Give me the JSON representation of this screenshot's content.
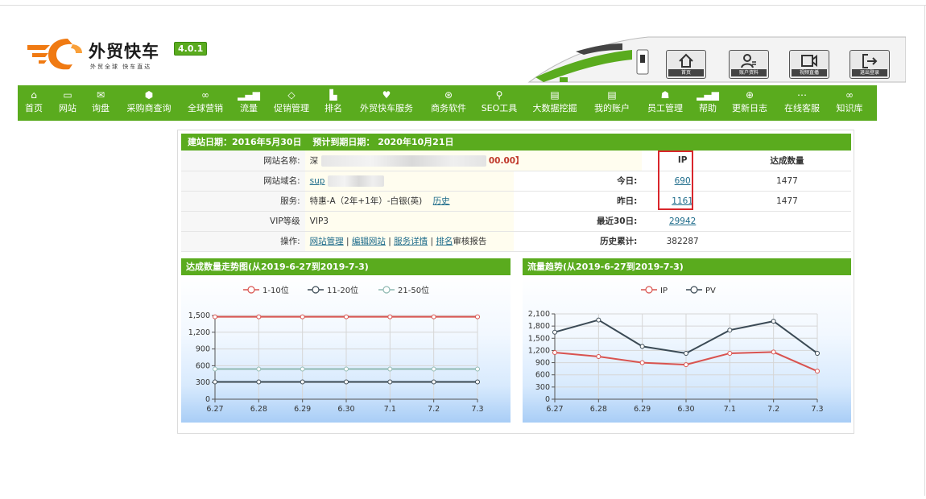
{
  "brand": {
    "title": "外贸快车",
    "version": "4.0.1",
    "slogan": "外贸全球 快车直达"
  },
  "top_buttons": [
    {
      "label": "首页",
      "icon": "home-icon"
    },
    {
      "label": "账户资料",
      "icon": "user-icon"
    },
    {
      "label": "视频直播",
      "icon": "video-icon"
    },
    {
      "label": "退出登录",
      "icon": "logout-icon"
    }
  ],
  "nav": [
    {
      "label": "首页",
      "icon": "⌂"
    },
    {
      "label": "网站",
      "icon": "▭"
    },
    {
      "label": "询盘",
      "icon": "✉"
    },
    {
      "label": "采购商查询",
      "icon": "⬢"
    },
    {
      "label": "全球营销",
      "icon": "∞"
    },
    {
      "label": "流量",
      "icon": "▂▄▆"
    },
    {
      "label": "促销管理",
      "icon": "◇"
    },
    {
      "label": "排名",
      "icon": "▙"
    },
    {
      "label": "外贸快车服务",
      "icon": "♥"
    },
    {
      "label": "商务软件",
      "icon": "⊛"
    },
    {
      "label": "SEO工具",
      "icon": "⚲"
    },
    {
      "label": "大数据挖掘",
      "icon": "▤"
    },
    {
      "label": "我的账户",
      "icon": "▤"
    },
    {
      "label": "员工管理",
      "icon": "☗"
    },
    {
      "label": "帮助",
      "icon": "▂▄▆"
    },
    {
      "label": "更新日志",
      "icon": "⊕"
    },
    {
      "label": "在线客服",
      "icon": "⋯"
    },
    {
      "label": "知识库",
      "icon": "∞"
    }
  ],
  "info": {
    "build_date": "建站日期：2016年5月30日",
    "expire_date": "预计到期日期：  2020年10月21日",
    "rows": [
      {
        "label": "网站名称:",
        "value": "深",
        "value_tail": "00.00】"
      },
      {
        "label": "网站域名:",
        "value": "sup"
      },
      {
        "label": "服务:",
        "value": "特惠-A（2年+1年）-白银(英)",
        "link": "历史"
      },
      {
        "label": "VIP等级",
        "value": "VIP3"
      },
      {
        "label": "操作:",
        "links": [
          "网站管理",
          "编辑网站",
          "服务详情",
          "排名"
        ],
        "tail": "审核报告"
      }
    ],
    "stats_header": {
      "ip": "IP",
      "count": "达成数量"
    },
    "stats": [
      {
        "label": "今日:",
        "ip": "690",
        "count": "1477"
      },
      {
        "label": "昨日:",
        "ip": "1161",
        "count": "1477"
      },
      {
        "label": "最近30日:",
        "ip": "29942",
        "count": ""
      },
      {
        "label": "历史累计:",
        "ip": "382287",
        "count": ""
      }
    ]
  },
  "chart_data": [
    {
      "type": "line",
      "title": "达成数量走势图(从2019-6-27到2019-7-3)",
      "x": [
        "6.27",
        "6.28",
        "6.29",
        "6.30",
        "7.1",
        "7.2",
        "7.3"
      ],
      "ylim": [
        0,
        1500
      ],
      "yticks": [
        "0",
        "300",
        "600",
        "900",
        "1,200",
        "1,500"
      ],
      "legend_position": "top-center",
      "series": [
        {
          "name": "1-10位",
          "color": "#d9534f",
          "values": [
            1477,
            1477,
            1477,
            1477,
            1477,
            1477,
            1477
          ]
        },
        {
          "name": "11-20位",
          "color": "#3b4a55",
          "values": [
            310,
            310,
            310,
            310,
            310,
            310,
            310
          ]
        },
        {
          "name": "21-50位",
          "color": "#8fb9b3",
          "values": [
            540,
            540,
            540,
            540,
            540,
            540,
            540
          ]
        }
      ]
    },
    {
      "type": "line",
      "title": "流量趋势(从2019-6-27到2019-7-3)",
      "x": [
        "6.27",
        "6.28",
        "6.29",
        "6.30",
        "7.1",
        "7.2",
        "7.3"
      ],
      "ylim": [
        0,
        2100
      ],
      "yticks": [
        "0",
        "300",
        "600",
        "900",
        "1,200",
        "1,500",
        "1,800",
        "2,100"
      ],
      "legend_position": "top-center",
      "series": [
        {
          "name": "IP",
          "color": "#d9534f",
          "values": [
            1150,
            1050,
            900,
            850,
            1130,
            1161,
            690
          ]
        },
        {
          "name": "PV",
          "color": "#3b4a55",
          "values": [
            1650,
            1950,
            1300,
            1130,
            1700,
            1920,
            1130
          ]
        }
      ]
    }
  ]
}
